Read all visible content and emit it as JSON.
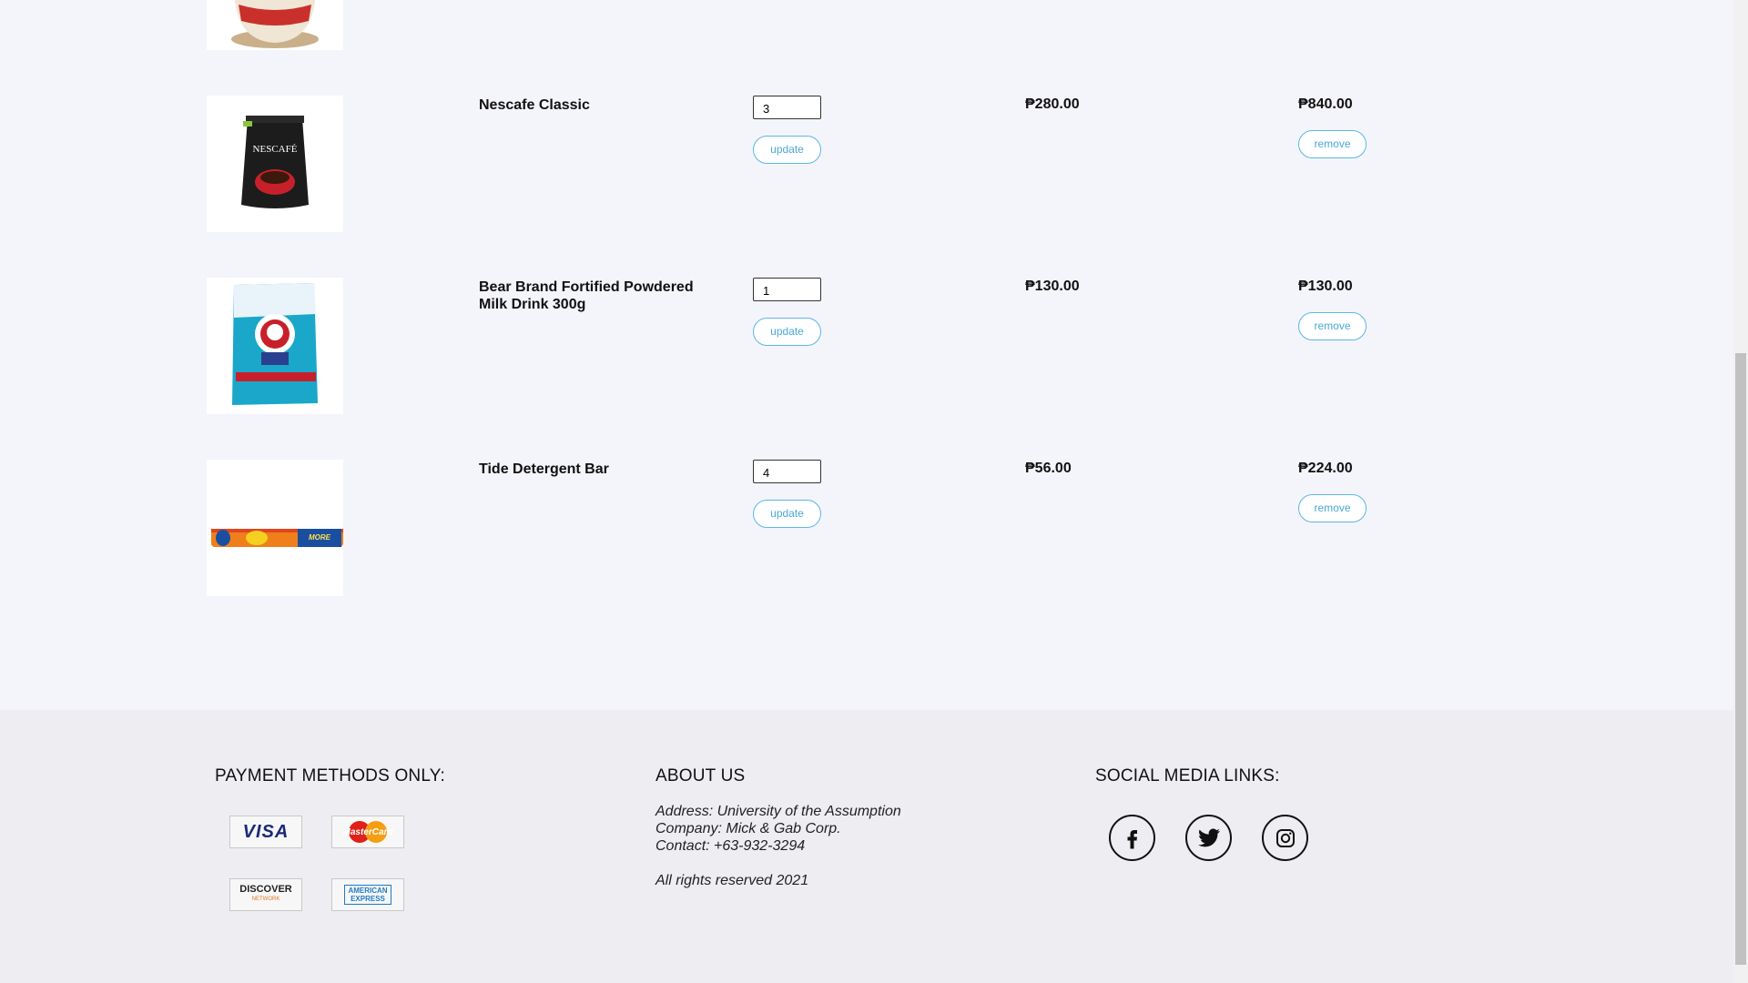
{
  "cart": {
    "items": [
      {
        "name": "",
        "image_icon": "coffee-cup-product-image"
      },
      {
        "name": "Nescafe Classic",
        "quantity": "3",
        "price": "₱280.00",
        "total": "₱840.00",
        "image_icon": "nescafe-pouch-image"
      },
      {
        "name": "Bear Brand Fortified Powdered Milk Drink 300g",
        "quantity": "1",
        "price": "₱130.00",
        "total": "₱130.00",
        "image_icon": "bear-brand-pack-image"
      },
      {
        "name": "Tide Detergent Bar",
        "quantity": "4",
        "price": "₱56.00",
        "total": "₱224.00",
        "image_icon": "tide-bar-image"
      }
    ],
    "update_label": "update",
    "remove_label": "remove"
  },
  "footer": {
    "payment_title": "PAYMENT METHODS ONLY:",
    "cards": [
      "VISA",
      "MasterCard",
      "DISCOVER",
      "AMERICAN EXPRESS"
    ],
    "discover_sub": "NETWORK",
    "about_title": "ABOUT US",
    "about_lines": [
      "Address: University of the Assumption",
      "Company: Mick & Gab Corp.",
      "Contact: +63-932-3294",
      "",
      "All rights reserved 2021"
    ],
    "social_title": "SOCIAL MEDIA LINKS:",
    "social_icons": [
      "facebook-icon",
      "twitter-icon",
      "instagram-icon"
    ]
  },
  "colors": {
    "accent": "#5bb7e6",
    "page_bg": "#f4f4fb",
    "footer_bg": "#ededf2"
  }
}
